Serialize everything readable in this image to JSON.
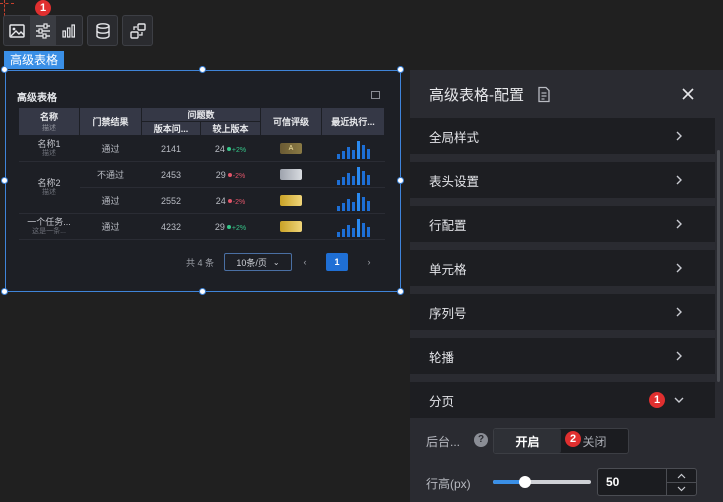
{
  "toolbar": {
    "badge": "1",
    "tools": [
      "image-icon",
      "sliders-icon",
      "bar-chart-icon",
      "database-icon",
      "data-transform-icon"
    ]
  },
  "widget": {
    "tag": "高级表格",
    "title": "高级表格"
  },
  "table": {
    "headers": {
      "name": "名称",
      "name_sub": "描述",
      "gate": "门禁结果",
      "problems": "问题数",
      "version_problems": "版本问...",
      "vs_prev": "较上版本",
      "rating": "可信评级",
      "recent": "最近执行..."
    },
    "rows": [
      {
        "name": "名称1",
        "desc": "描述",
        "gate": "通过",
        "count": "2141",
        "delta_num": "24",
        "delta": "+2%",
        "dir": "up",
        "rating": "A"
      },
      {
        "name": "名称2",
        "desc": "描述",
        "gate": "不通过",
        "count": "2453",
        "delta_num": "29",
        "delta": "-2%",
        "dir": "down",
        "rating": ""
      },
      {
        "name": "",
        "desc": "",
        "gate": "通过",
        "count": "2552",
        "delta_num": "24",
        "delta": "-2%",
        "dir": "down",
        "rating": ""
      },
      {
        "name": "一个任务...",
        "desc": "这是一条...",
        "gate": "通过",
        "count": "4232",
        "delta_num": "29",
        "delta": "+2%",
        "dir": "up",
        "rating": ""
      }
    ],
    "pager": {
      "total": "共 4 条",
      "page_size": "10条/页",
      "current_page": "1"
    }
  },
  "panel": {
    "title": "高级表格-配置",
    "sections": [
      {
        "label": "全局样式",
        "expanded": false
      },
      {
        "label": "表头设置",
        "expanded": false
      },
      {
        "label": "行配置",
        "expanded": false
      },
      {
        "label": "单元格",
        "expanded": false
      },
      {
        "label": "序列号",
        "expanded": false
      },
      {
        "label": "轮播",
        "expanded": false
      },
      {
        "label": "分页",
        "expanded": true,
        "badge": "1"
      }
    ],
    "backend_label": "后台...",
    "segment": {
      "on": "开启",
      "off": "关闭",
      "badge": "2"
    },
    "row_height_label": "行高(px)",
    "row_height_value": "50",
    "row_height_slider": 0.33
  },
  "colors": {
    "accent": "#3a8fe6",
    "badge_red": "#e02f2f",
    "up_green": "#35c78a",
    "down_red": "#e2556a"
  }
}
